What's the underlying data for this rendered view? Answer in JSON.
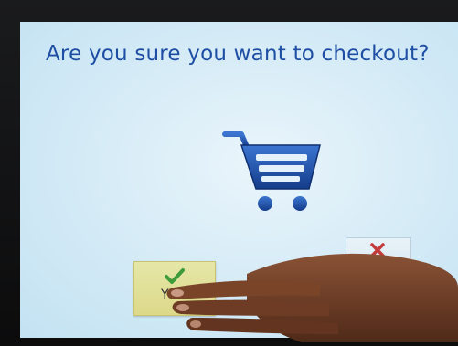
{
  "screen": {
    "title": "Are you sure you want to checkout?",
    "cart_icon": "shopping-cart-icon",
    "confirm_button": {
      "label": "Yes",
      "icon": "check-icon"
    },
    "cancel_button": {
      "icon": "close-icon"
    }
  },
  "colors": {
    "screen_bg": "#d7ecf7",
    "title_text": "#1e4ea3",
    "cart_blue": "#1c4fa8",
    "yes_button_bg": "#e0dd95",
    "check_green": "#3f9a3a",
    "cancel_x_red": "#c23a3a"
  }
}
